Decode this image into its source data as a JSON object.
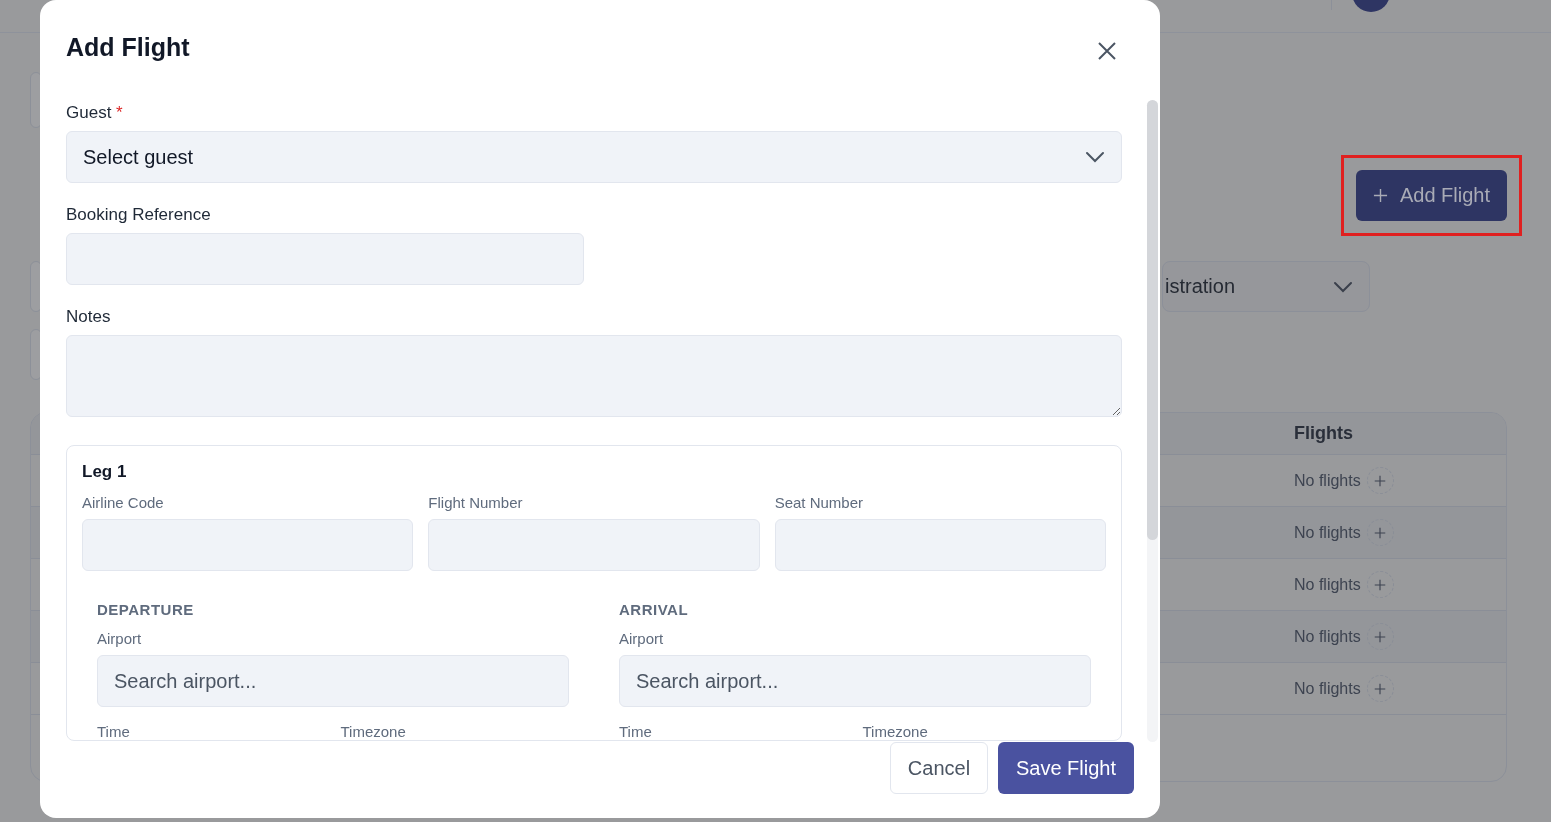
{
  "background": {
    "add_button": "Add Flight",
    "filter_select": "istration",
    "table": {
      "column_header": "Flights",
      "rows": [
        {
          "flights": "No flights"
        },
        {
          "flights": "No flights"
        },
        {
          "flights": "No flights"
        },
        {
          "flights": "No flights"
        },
        {
          "flights": "No flights"
        }
      ]
    }
  },
  "modal": {
    "title": "Add Flight",
    "guest": {
      "label": "Guest",
      "required_mark": "*",
      "placeholder": "Select guest"
    },
    "booking_reference": {
      "label": "Booking Reference"
    },
    "notes": {
      "label": "Notes"
    },
    "leg": {
      "title": "Leg 1",
      "fields": [
        {
          "label": "Airline Code"
        },
        {
          "label": "Flight Number"
        },
        {
          "label": "Seat Number"
        }
      ],
      "sections": [
        {
          "heading": "DEPARTURE",
          "airport_label": "Airport",
          "airport_placeholder": "Search airport...",
          "time_label": "Time",
          "timezone_label": "Timezone"
        },
        {
          "heading": "ARRIVAL",
          "airport_label": "Airport",
          "airport_placeholder": "Search airport...",
          "time_label": "Time",
          "timezone_label": "Timezone"
        }
      ]
    },
    "buttons": {
      "cancel": "Cancel",
      "save": "Save Flight"
    }
  }
}
